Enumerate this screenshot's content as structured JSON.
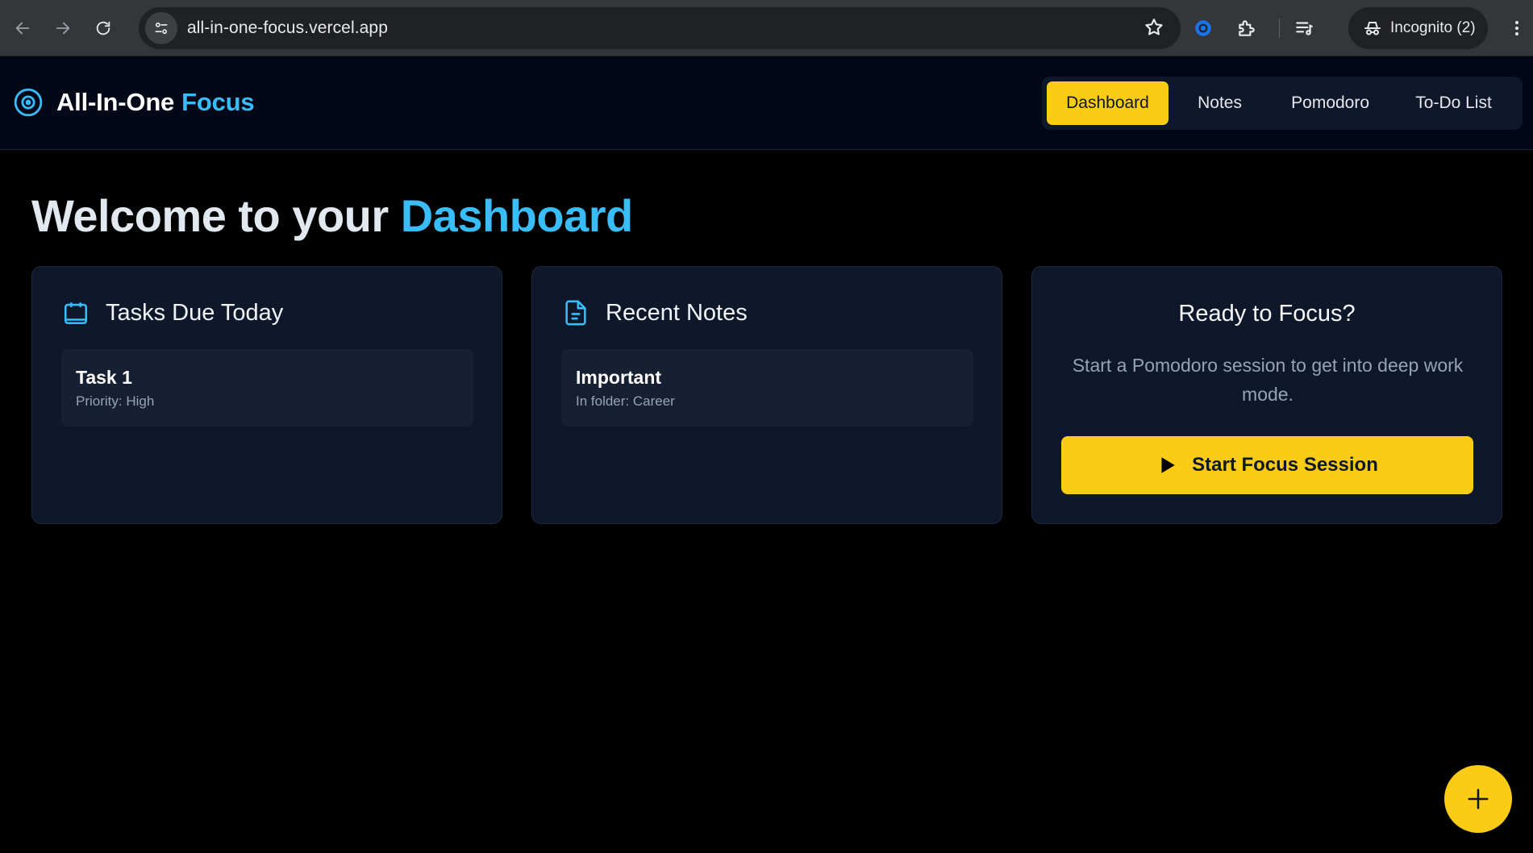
{
  "browser": {
    "url": "all-in-one-focus.vercel.app",
    "incognito_label": "Incognito (2)",
    "icons": [
      "back-arrow-icon",
      "forward-arrow-icon",
      "reload-icon",
      "site-info-icon",
      "bookmark-star-icon",
      "extension-circle-icon",
      "puzzle-extensions-icon",
      "media-controls-icon",
      "incognito-icon",
      "kebab-menu-icon"
    ]
  },
  "header": {
    "brand_main": "All-In-One",
    "brand_accent": "Focus",
    "nav": [
      {
        "label": "Dashboard",
        "active": true
      },
      {
        "label": "Notes",
        "active": false
      },
      {
        "label": "Pomodoro",
        "active": false
      },
      {
        "label": "To-Do List",
        "active": false
      }
    ]
  },
  "main": {
    "welcome_prefix": "Welcome to your",
    "welcome_accent": "Dashboard",
    "tasks_card": {
      "title": "Tasks Due Today",
      "icon": "calendar-icon",
      "items": [
        {
          "title": "Task 1",
          "subtitle": "Priority: High"
        }
      ]
    },
    "notes_card": {
      "title": "Recent Notes",
      "icon": "document-icon",
      "items": [
        {
          "title": "Important",
          "subtitle": "In folder: Career"
        }
      ]
    },
    "focus_card": {
      "title": "Ready to Focus?",
      "description": "Start a Pomodoro session to get into deep work mode.",
      "button_label": "Start Focus Session",
      "button_icon": "play-icon"
    }
  },
  "fab": {
    "icon": "plus-icon"
  },
  "colors": {
    "accent": "#38bdf8",
    "primary_button": "#facc15",
    "background": "#000000",
    "card": "#0f172a"
  }
}
